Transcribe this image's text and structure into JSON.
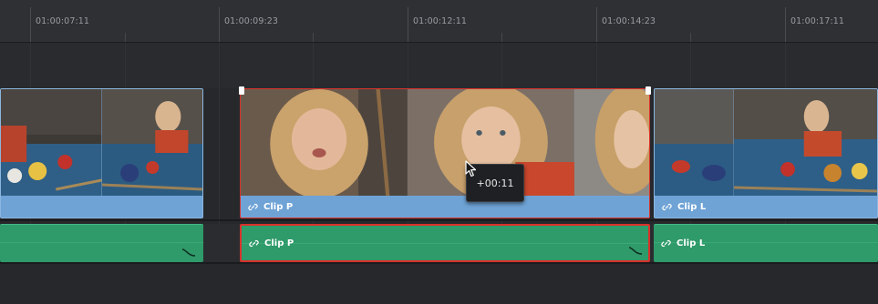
{
  "ruler": {
    "timecodes": [
      "01:00:07:11",
      "01:00:09:23",
      "01:00:12:11",
      "01:00:14:23",
      "01:00:17:11"
    ]
  },
  "video_track": {
    "clips": [
      {
        "name": "",
        "selected": false
      },
      {
        "name": "Clip P",
        "selected": true
      },
      {
        "name": "Clip L",
        "selected": false
      }
    ]
  },
  "audio_track": {
    "clips": [
      {
        "name": "",
        "selected": false
      },
      {
        "name": "Clip P",
        "selected": true
      },
      {
        "name": "Clip L",
        "selected": false
      }
    ]
  },
  "tooltip": {
    "offset": "+00:11"
  },
  "colors": {
    "video_clip": "#6fa3d6",
    "audio_clip": "#2f9a6a",
    "selection": "#d9312b"
  },
  "icons": {
    "link": "link-icon",
    "audio_curve": "audio-curve-icon",
    "pointer": "arrow-cursor-icon"
  }
}
